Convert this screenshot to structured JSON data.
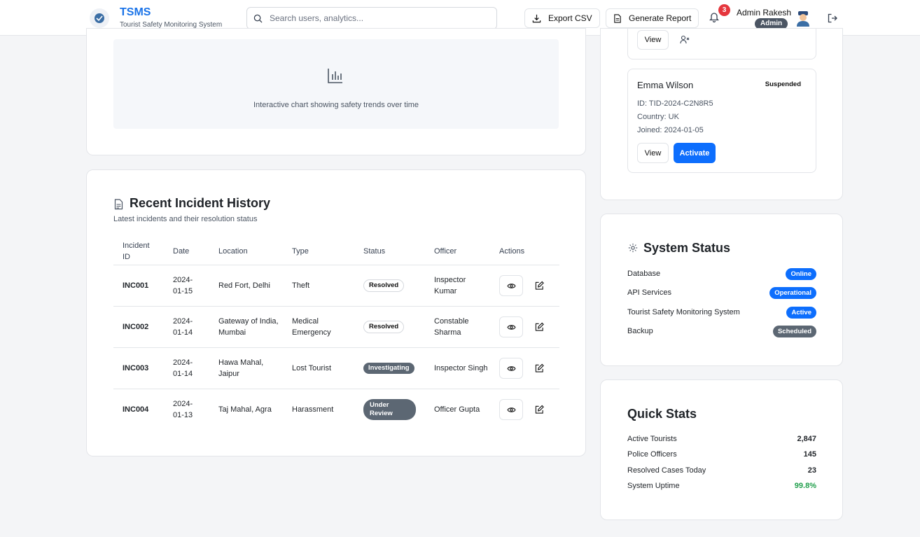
{
  "header": {
    "brand_title": "TSMS",
    "brand_subtitle": "Tourist Safety Monitoring System",
    "search_placeholder": "Search users, analytics...",
    "export_label": "Export CSV",
    "report_label": "Generate Report",
    "notification_count": "3",
    "user_name": "Admin Rakesh",
    "user_role": "Admin"
  },
  "chart_panel": {
    "caption": "Interactive chart showing safety trends over time"
  },
  "incidents": {
    "title": "Recent Incident History",
    "subtitle": "Latest incidents and their resolution status",
    "columns": [
      "Incident ID",
      "Date",
      "Location",
      "Type",
      "Status",
      "Officer",
      "Actions"
    ],
    "rows": [
      {
        "id": "INC001",
        "date": "2024-01-15",
        "location": "Red Fort, Delhi",
        "type": "Theft",
        "status": "Resolved",
        "officer": "Inspector Kumar"
      },
      {
        "id": "INC002",
        "date": "2024-01-14",
        "location": "Gateway of India, Mumbai",
        "type": "Medical Emergency",
        "status": "Resolved",
        "officer": "Constable Sharma"
      },
      {
        "id": "INC003",
        "date": "2024-01-14",
        "location": "Hawa Mahal, Jaipur",
        "type": "Lost Tourist",
        "status": "Investigating",
        "officer": "Inspector Singh"
      },
      {
        "id": "INC004",
        "date": "2024-01-13",
        "location": "Taj Mahal, Agra",
        "type": "Harassment",
        "status": "Under Review",
        "officer": "Officer Gupta"
      }
    ]
  },
  "users": {
    "prev_view_label": "View",
    "card": {
      "name": "Emma Wilson",
      "status": "Suspended",
      "id_line": "ID: TID-2024-C2N8R5",
      "country_line": "Country: UK",
      "joined_line": "Joined: 2024-01-05",
      "view_label": "View",
      "activate_label": "Activate"
    }
  },
  "system_status": {
    "title": "System Status",
    "items": [
      {
        "label": "Database",
        "status": "Online",
        "color": "#0d6efd"
      },
      {
        "label": "API Services",
        "status": "Operational",
        "color": "#0d6efd"
      },
      {
        "label": "Tourist Safety Monitoring System",
        "status": "Active",
        "color": "#0d6efd"
      },
      {
        "label": "Backup",
        "status": "Scheduled",
        "color": "#5c6773"
      }
    ]
  },
  "quick_stats": {
    "title": "Quick Stats",
    "items": [
      {
        "label": "Active Tourists",
        "value": "2,847"
      },
      {
        "label": "Police Officers",
        "value": "145"
      },
      {
        "label": "Resolved Cases Today",
        "value": "23"
      },
      {
        "label": "System Uptime",
        "value": "99.8%",
        "color": "#1e9e4a"
      }
    ]
  },
  "colors": {
    "accent": "#0d6efd",
    "brand": "#1a73e8",
    "danger": "#e5363d",
    "success": "#1e9e4a",
    "neutral_pill": "#5c6773"
  }
}
